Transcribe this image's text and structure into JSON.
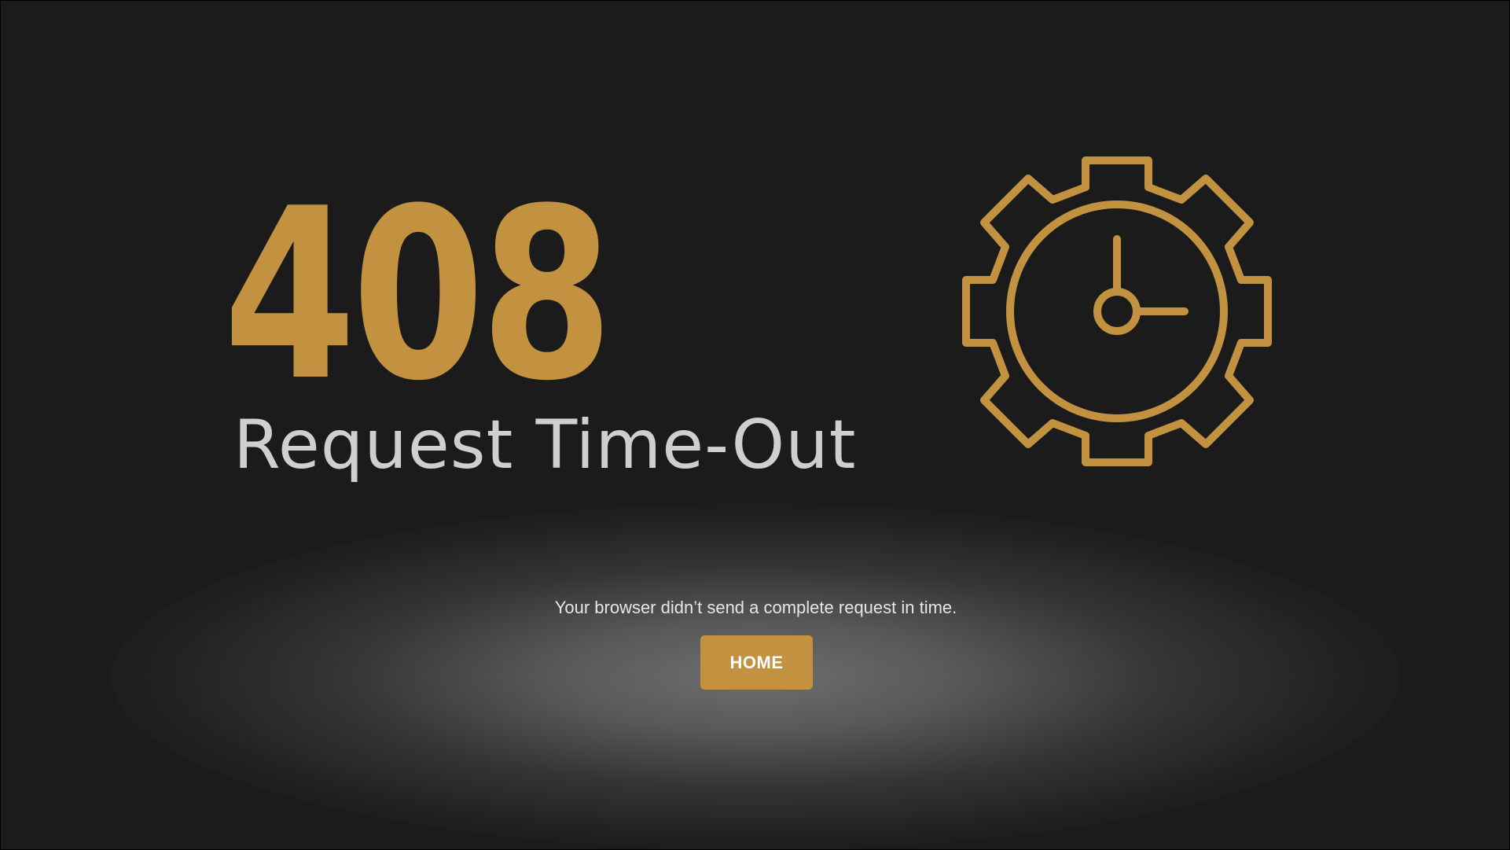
{
  "error": {
    "code": "408",
    "title": "Request Time-Out",
    "message": "Your browser didn’t send a complete request in time."
  },
  "actions": {
    "home_label": "HOME"
  },
  "icons": {
    "main": "gear-clock-icon"
  },
  "colors": {
    "background": "#1b1b1b",
    "accent": "#c29241",
    "title_text": "#cfcfcf",
    "message_text": "#e6e6e6",
    "button_text": "#ffffff"
  }
}
